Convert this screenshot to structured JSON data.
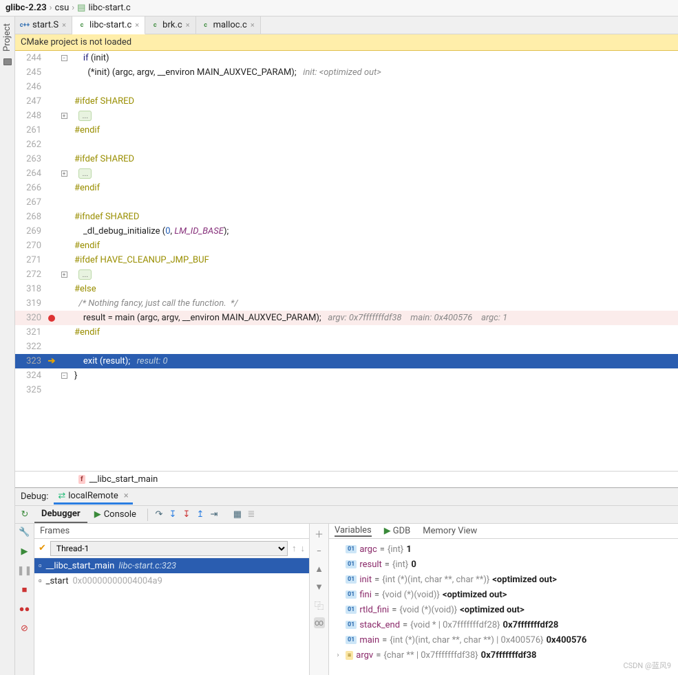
{
  "crumbs": {
    "a": "glibc-2.23",
    "b": "csu",
    "c": "libc-start.c"
  },
  "tabs": [
    {
      "label": "start.S",
      "kind": "cpp"
    },
    {
      "label": "libc-start.c",
      "kind": "c",
      "active": true
    },
    {
      "label": "brk.c",
      "kind": "c"
    },
    {
      "label": "malloc.c",
      "kind": "c"
    }
  ],
  "banner": "CMake project is not loaded",
  "sidebar_label": "Project",
  "status_fn": "__libc_start_main",
  "code_lines": [
    {
      "n": 244,
      "fold": "-",
      "src": [
        {
          "t": "    "
        },
        {
          "t": "if",
          "c": "k-kw"
        },
        {
          "t": " (init)"
        }
      ]
    },
    {
      "n": 245,
      "src": [
        {
          "t": "      (*init) (argc, argv, __environ MAIN_AUXVEC_PARAM);   "
        },
        {
          "t": "init: <optimized out>",
          "c": "k-cm"
        }
      ]
    },
    {
      "n": 246,
      "src": []
    },
    {
      "n": 247,
      "src": [
        {
          "t": "#ifdef SHARED",
          "c": "k-pre"
        }
      ]
    },
    {
      "n": 248,
      "fold": "+",
      "src": [
        {
          "t": "  "
        },
        {
          "box": "..."
        }
      ]
    },
    {
      "n": 261,
      "src": [
        {
          "t": "#endif",
          "c": "k-pre"
        }
      ]
    },
    {
      "n": 262,
      "src": []
    },
    {
      "n": 263,
      "src": [
        {
          "t": "#ifdef SHARED",
          "c": "k-pre"
        }
      ]
    },
    {
      "n": 264,
      "fold": "+",
      "src": [
        {
          "t": "  "
        },
        {
          "box": "..."
        }
      ]
    },
    {
      "n": 266,
      "src": [
        {
          "t": "#endif",
          "c": "k-pre"
        }
      ]
    },
    {
      "n": 267,
      "src": []
    },
    {
      "n": 268,
      "src": [
        {
          "t": "#ifndef SHARED",
          "c": "k-pre"
        }
      ]
    },
    {
      "n": 269,
      "src": [
        {
          "t": "    _dl_debug_initialize ("
        },
        {
          "t": "0",
          "c": "k-num"
        },
        {
          "t": ", "
        },
        {
          "t": "LM_ID_BASE",
          "c": "k-id"
        },
        {
          "t": ");"
        }
      ]
    },
    {
      "n": 270,
      "src": [
        {
          "t": "#endif",
          "c": "k-pre"
        }
      ]
    },
    {
      "n": 271,
      "src": [
        {
          "t": "#ifdef HAVE_CLEANUP_JMP_BUF",
          "c": "k-pre"
        }
      ]
    },
    {
      "n": 272,
      "fold": "+",
      "src": [
        {
          "t": "  "
        },
        {
          "box": "..."
        }
      ]
    },
    {
      "n": 318,
      "src": [
        {
          "t": "#else",
          "c": "k-pre"
        }
      ]
    },
    {
      "n": 319,
      "src": [
        {
          "t": "  /* Nothing fancy, just call the function.  */",
          "c": "k-cm"
        }
      ]
    },
    {
      "n": 320,
      "hl": true,
      "bp": true,
      "src": [
        {
          "t": "    result = main (argc, argv, __environ MAIN_AUXVEC_PARAM);   "
        },
        {
          "t": "argv: 0x7fffffffdf38    main: 0x400576    argc: 1",
          "c": "k-cm"
        }
      ]
    },
    {
      "n": 321,
      "src": [
        {
          "t": "#endif",
          "c": "k-pre"
        }
      ]
    },
    {
      "n": 322,
      "src": []
    },
    {
      "n": 323,
      "cur": true,
      "arrow": true,
      "src": [
        {
          "t": "    exit (result);   "
        },
        {
          "t": "result: 0",
          "c": "k-cm"
        }
      ]
    },
    {
      "n": 324,
      "fold": "-",
      "src": [
        {
          "t": "}"
        }
      ]
    },
    {
      "n": 325,
      "src": []
    }
  ],
  "debug": {
    "label": "Debug:",
    "config": "localRemote",
    "tabs": {
      "debugger": "Debugger",
      "console": "Console"
    },
    "frames": {
      "title": "Frames",
      "thread": "Thread-1",
      "rows": [
        {
          "name": "__libc_start_main",
          "loc": "libc-start.c:323",
          "sel": true
        },
        {
          "name": "_start",
          "loc": "0x00000000004004a9"
        }
      ]
    },
    "vars": {
      "tabs": {
        "v": "Variables",
        "g": "GDB",
        "m": "Memory View"
      },
      "rows": [
        {
          "b": "01",
          "nm": "argc",
          "tp": "{int}",
          "vl": "1"
        },
        {
          "b": "01",
          "nm": "result",
          "tp": "{int}",
          "vl": "0"
        },
        {
          "b": "01",
          "nm": "init",
          "tp": "{int (*)(int, char **, char **)}",
          "vl": "<optimized out>"
        },
        {
          "b": "01",
          "nm": "fini",
          "tp": "{void (*)(void)}",
          "vl": "<optimized out>"
        },
        {
          "b": "01",
          "nm": "rtld_fini",
          "tp": "{void (*)(void)}",
          "vl": "<optimized out>"
        },
        {
          "b": "01",
          "nm": "stack_end",
          "tp": "{void * | 0x7fffffffdf28}",
          "vl": "0x7fffffffdf28"
        },
        {
          "b": "01",
          "nm": "main",
          "tp": "{int (*)(int, char **, char **) | 0x400576}",
          "vl": "0x400576"
        },
        {
          "b": "y",
          "nm": "argv",
          "tp": "{char ** | 0x7fffffffdf38}",
          "vl": "0x7fffffffdf38",
          "exp": true
        }
      ]
    }
  },
  "watermark": "CSDN @蓝风9"
}
